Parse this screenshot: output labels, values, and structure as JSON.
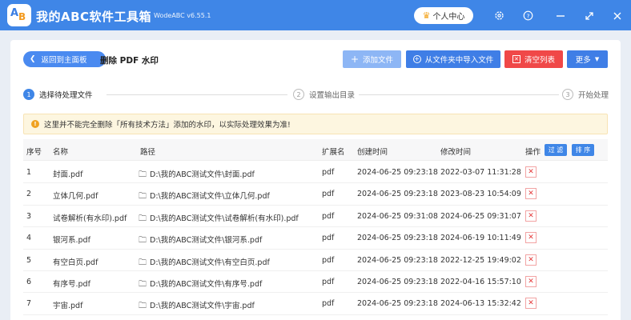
{
  "app": {
    "logo_a": "A",
    "logo_b": "B",
    "title": "我的ABC软件工具箱",
    "version": "WodeABC v6.55.1",
    "user_center": "个人中心"
  },
  "toolbar": {
    "back_label": "返回到主面板",
    "page_title": "删除 PDF 水印",
    "add_files": "添加文件",
    "import_folder": "从文件夹中导入文件",
    "clear_list": "清空列表",
    "more": "更多"
  },
  "steps": [
    {
      "num": "1",
      "label": "选择待处理文件"
    },
    {
      "num": "2",
      "label": "设置输出目录"
    },
    {
      "num": "3",
      "label": "开始处理"
    }
  ],
  "notice": "这里并不能完全删除「所有技术方法」添加的水印，以实际处理效果为准!",
  "table": {
    "headers": {
      "index": "序号",
      "name": "名称",
      "path": "路径",
      "ext": "扩展名",
      "created": "创建时间",
      "modified": "修改时间",
      "actions": "操作",
      "filter": "过 滤",
      "sort": "排 序"
    },
    "rows": [
      {
        "index": "1",
        "name": "封面.pdf",
        "path": "D:\\我的ABC测试文件\\封面.pdf",
        "ext": "pdf",
        "created": "2024-06-25 09:23:18",
        "modified": "2022-03-07 11:31:28"
      },
      {
        "index": "2",
        "name": "立体几何.pdf",
        "path": "D:\\我的ABC测试文件\\立体几何.pdf",
        "ext": "pdf",
        "created": "2024-06-25 09:23:18",
        "modified": "2023-08-23 10:54:09"
      },
      {
        "index": "3",
        "name": "试卷解析(有水印).pdf",
        "path": "D:\\我的ABC测试文件\\试卷解析(有水印).pdf",
        "ext": "pdf",
        "created": "2024-06-25 09:31:08",
        "modified": "2024-06-25 09:31:07"
      },
      {
        "index": "4",
        "name": "银河系.pdf",
        "path": "D:\\我的ABC测试文件\\银河系.pdf",
        "ext": "pdf",
        "created": "2024-06-25 09:23:18",
        "modified": "2024-06-19 10:11:49"
      },
      {
        "index": "5",
        "name": "有空白页.pdf",
        "path": "D:\\我的ABC测试文件\\有空白页.pdf",
        "ext": "pdf",
        "created": "2024-06-25 09:23:18",
        "modified": "2022-12-25 19:49:02"
      },
      {
        "index": "6",
        "name": "有序号.pdf",
        "path": "D:\\我的ABC测试文件\\有序号.pdf",
        "ext": "pdf",
        "created": "2024-06-25 09:23:18",
        "modified": "2022-04-16 15:57:10"
      },
      {
        "index": "7",
        "name": "宇宙.pdf",
        "path": "D:\\我的ABC测试文件\\宇宙.pdf",
        "ext": "pdf",
        "created": "2024-06-25 09:23:18",
        "modified": "2024-06-13 15:32:42"
      }
    ]
  },
  "colors": {
    "titlebar": "#3f86e7",
    "primary": "#3f7ee6",
    "danger": "#f04848",
    "notice_bg": "#fdf6e0"
  }
}
